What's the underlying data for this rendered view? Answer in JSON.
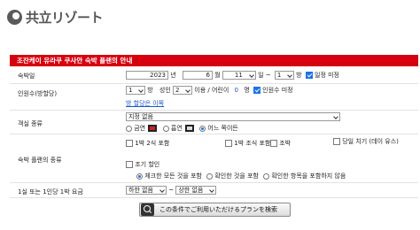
{
  "logo": {
    "text": "共立リゾート"
  },
  "form": {
    "title": "조잔케이 유라쿠 쿠사안 숙박 플랜의 안내",
    "checkin": {
      "label": "숙박일",
      "year": "2023",
      "year_unit": "년",
      "month": "6",
      "month_unit": "월",
      "day": "11",
      "day_unit": "일 ~",
      "nights": "1",
      "nights_unit": "방",
      "undecided_label": "일정 미정",
      "undecided_checked": true
    },
    "guests": {
      "label": "인원수(방할당)",
      "rooms": "1",
      "rooms_unit": "방",
      "adults_prefix": "성인",
      "adults": "2",
      "adults_unit": "이용 / 어린이",
      "children": "0",
      "children_unit": "명",
      "undecided_label": "인원수 미정",
      "undecided_checked": true,
      "room_allocation_link": "방 할당은 이쪽"
    },
    "room_type": {
      "label": "객실 종류",
      "selected": "지정 없음",
      "options": [
        {
          "label": "금연",
          "checked": false,
          "icon": "non-smoking-icon"
        },
        {
          "label": "흡연",
          "checked": false,
          "icon": "smoking-icon"
        },
        {
          "label": "어느 쪽이든",
          "checked": true,
          "icon": ""
        }
      ]
    },
    "plan_type": {
      "label": "숙박 플랜의 종류",
      "checkboxes": [
        "1박 2식 포함",
        "1박 조식 포함",
        "조박",
        "당일 치기 (데이 유스)",
        "조기 할인"
      ],
      "radios": [
        {
          "label": "체크한 모든 것을 포함",
          "checked": true
        },
        {
          "label": "확인한 것을 포함",
          "checked": false
        },
        {
          "label": "확인한 항목을 포함하지 않음",
          "checked": false
        }
      ]
    },
    "price": {
      "label": "1실 또는 1인당 1박 요금",
      "min": "하한 없음",
      "separator": "~",
      "max": "상한 없음"
    },
    "search_button": "この条件でご利用いただけるプランを検索"
  }
}
